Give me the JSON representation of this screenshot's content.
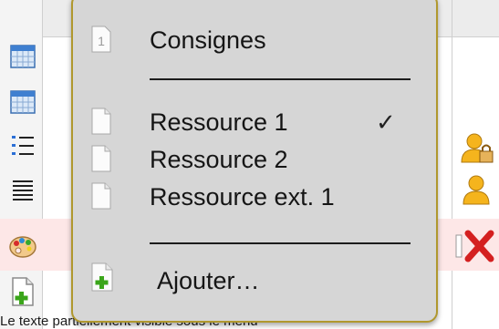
{
  "menu": {
    "items": [
      {
        "label": "Consignes",
        "icon": "numbered-page-icon",
        "icon_number": "1"
      },
      {
        "label": "Ressource 1",
        "icon": "blank-page-icon",
        "checked": true
      },
      {
        "label": "Ressource 2",
        "icon": "blank-page-icon"
      },
      {
        "label": "Ressource ext. 1",
        "icon": "blank-page-icon"
      },
      {
        "label": "Ajouter…",
        "icon": "add-page-icon"
      }
    ],
    "check_mark": "✓"
  },
  "left_toolbar": [
    "calendar-icon",
    "calendar-icon",
    "numbered-list-icon",
    "text-lines-icon",
    "palette-icon",
    "add-page-icon"
  ],
  "right_toolbar": [
    "user-lock-icon",
    "user-icon",
    "delete-icon"
  ],
  "background_text": "Le texte partiellement visible sous le menu",
  "colors": {
    "menu_border": "#b0982e",
    "menu_bg": "#d6d6d6",
    "highlight_row": "#fde7e7",
    "add_green": "#3aa51a",
    "delete_red": "#d42020"
  }
}
